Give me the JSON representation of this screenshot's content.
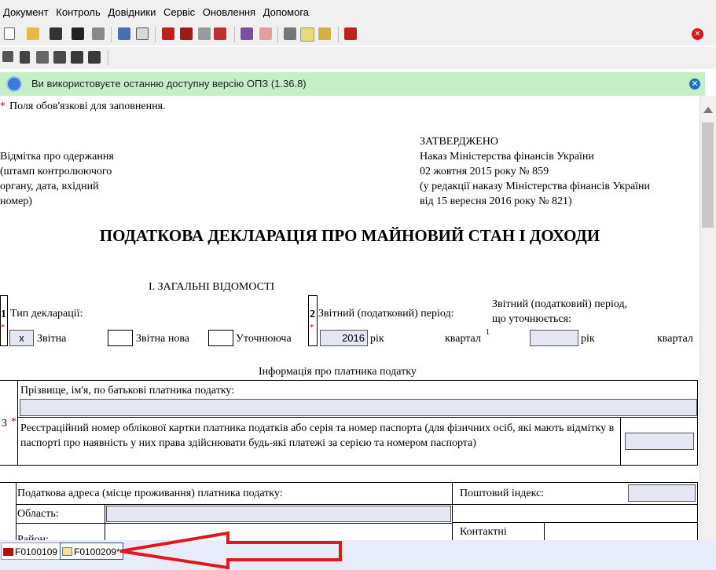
{
  "menu": [
    "Документ",
    "Контроль",
    "Довідники",
    "Сервіс",
    "Оновлення",
    "Допомога"
  ],
  "toolbar1_icons": [
    "new-doc-icon",
    "open-folder-icon",
    "save-icon",
    "save-all-icon",
    "print-icon",
    "check-icon",
    "checklist-icon",
    "home-icon",
    "books-icon",
    "copy-icon",
    "alert-icon",
    "edit-icon",
    "report-icon",
    "properties-icon",
    "form-icon",
    "attach-icon",
    "exit-icon",
    "close-red-icon"
  ],
  "toolbar2_icons": [
    "copy-row-icon",
    "cut-icon",
    "paste-icon",
    "insert-row-icon",
    "insert-tree-icon",
    "delete-tree-icon"
  ],
  "banner": {
    "text": "Ви використовуєте останню доступну версію ОПЗ (1.36.8)"
  },
  "form": {
    "required_star": "*",
    "required_note": "Поля обов'язкові для заповнення.",
    "receipt_lines": [
      "Відмітка про одержання",
      "(штамп контролюючого",
      "органу, дата, вхідний",
      "номер)"
    ],
    "approved": "ЗАТВЕРДЖЕНО",
    "approved_lines": [
      "Наказ Міністерства фінансів України",
      "02 жовтня 2015 року № 859",
      "(у редакції наказу Міністерства фінансів України",
      "від 15 вересня 2016 року № 821)"
    ],
    "title": "ПОДАТКОВА ДЕКЛАРАЦІЯ ПРО МАЙНОВИЙ СТАН І ДОХОДИ",
    "section": "І. ЗАГАЛЬНІ ВІДОМОСТІ",
    "row1_num": "1",
    "decl_type_label": "Тип декларації:",
    "checked_mark": "x",
    "type_opts": [
      "Звітна",
      "Звітна нова",
      "Уточнююча"
    ],
    "row2_num": "2",
    "period_label": "Звітний (податковий) період:",
    "period_year": "2016",
    "year_word": "рік",
    "quarter_word": "квартал",
    "footnote": "1",
    "period_spec_label_1": "Звітний (податковий) період,",
    "period_spec_label_2": "що уточнюється:",
    "payer_info_title": "Інформація про платника податку",
    "row3_num": "3",
    "name_label": "Прізвище, ім'я, по батькові платника податку:",
    "reg_label": "Реєстраційний номер облікової картки платника податків або серія та номер паспорта (для фізичних осіб, які мають відмітку в паспорті про наявність у них права здійснювати будь-які платежі за серією та номером паспорта)",
    "address_label": "Податкова адреса (місце проживання) платника податку:",
    "region_label": "Область:",
    "district_label": "Район:",
    "postal_label": "Поштовий індекс:",
    "contacts_label": "Контактні"
  },
  "tabs": [
    "F0100109",
    "F0100209*"
  ]
}
